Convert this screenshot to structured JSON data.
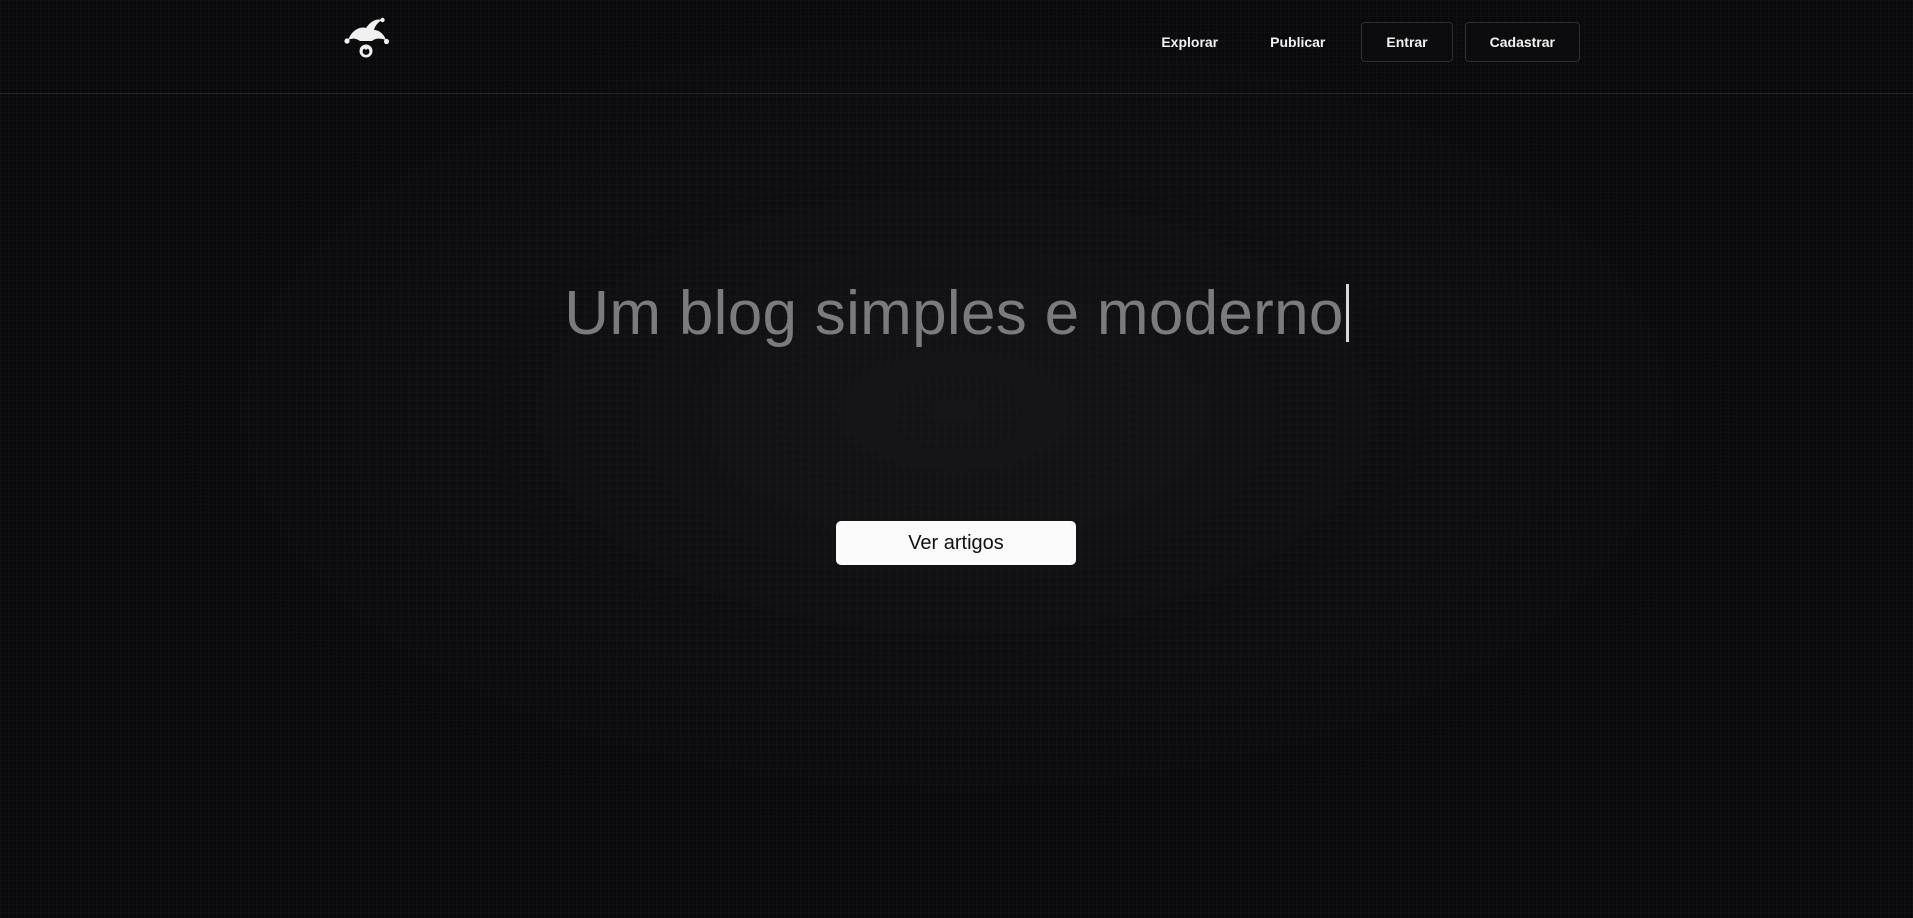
{
  "header": {
    "logo_icon": "jester-hat-icon",
    "nav": {
      "explore_label": "Explorar",
      "publish_label": "Publicar",
      "login_label": "Entrar",
      "signup_label": "Cadastrar"
    }
  },
  "hero": {
    "headline": "Um blog simples e moderno",
    "cta_label": "Ver artigos"
  },
  "colors": {
    "background": "#0a0a0c",
    "headline": "#7b7b7f",
    "cta_background": "#fafafa",
    "nav_text": "#f2f2f2"
  }
}
